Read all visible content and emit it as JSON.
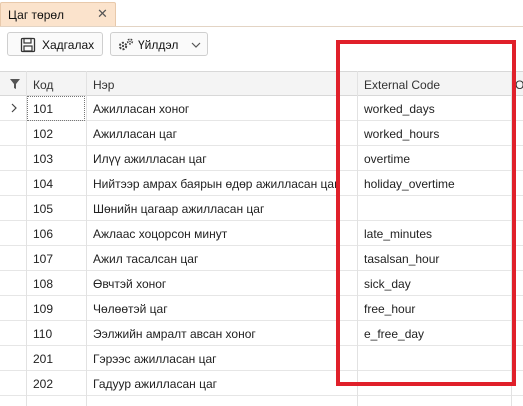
{
  "tab": {
    "title": "Цаг төрөл",
    "close_symbol": "✕"
  },
  "toolbar": {
    "save_label": "Хадгалах",
    "actions_label": "Үйлдэл"
  },
  "grid": {
    "columns": {
      "code": "Код",
      "name": "Нэр",
      "external_code": "External Code",
      "extra": "O"
    },
    "rows": [
      {
        "code": "101",
        "name": "Ажилласан хоног",
        "external_code": "worked_days"
      },
      {
        "code": "102",
        "name": "Ажилласан цаг",
        "external_code": "worked_hours"
      },
      {
        "code": "103",
        "name": "Илүү ажилласан цаг",
        "external_code": "overtime"
      },
      {
        "code": "104",
        "name": "Нийтээр амрах баярын өдөр ажилласан цаг",
        "external_code": "holiday_overtime"
      },
      {
        "code": "105",
        "name": "Шөнийн цагаар ажилласан цаг",
        "external_code": ""
      },
      {
        "code": "106",
        "name": "Ажлаас хоцорсон минут",
        "external_code": "late_minutes"
      },
      {
        "code": "107",
        "name": "Ажил тасалсан цаг",
        "external_code": "tasalsan_hour"
      },
      {
        "code": "108",
        "name": "Өвчтэй хоног",
        "external_code": "sick_day"
      },
      {
        "code": "109",
        "name": "Чөлөөтэй цаг",
        "external_code": "free_hour"
      },
      {
        "code": "110",
        "name": "Ээлжийн амралт авсан хоног",
        "external_code": "e_free_day"
      },
      {
        "code": "201",
        "name": "Гэрээс ажилласан цаг",
        "external_code": ""
      },
      {
        "code": "202",
        "name": "Гадуур ажилласан цаг",
        "external_code": ""
      }
    ]
  },
  "icons": {
    "save": "save-icon",
    "actions": "gear-icon",
    "filter": "filter-icon",
    "row_indicator": "chevron-right-icon"
  },
  "colors": {
    "tab_active": "#fbe3cc",
    "highlight_box": "#e0202a"
  }
}
